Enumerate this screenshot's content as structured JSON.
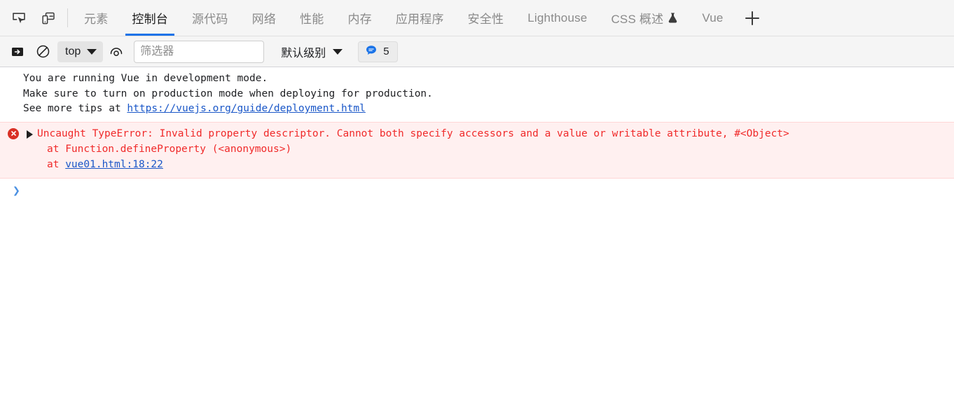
{
  "window": {
    "title": "Chrome DevTools - Console"
  },
  "tabbar": {
    "inspect_icon": "inspect-element-icon",
    "device_icon": "device-toolbar-icon",
    "add_label": "+",
    "tabs": [
      {
        "label": "元素",
        "name": "elements",
        "active": false
      },
      {
        "label": "控制台",
        "name": "console",
        "active": true
      },
      {
        "label": "源代码",
        "name": "sources",
        "active": false
      },
      {
        "label": "网络",
        "name": "network",
        "active": false
      },
      {
        "label": "性能",
        "name": "performance",
        "active": false
      },
      {
        "label": "内存",
        "name": "memory",
        "active": false
      },
      {
        "label": "应用程序",
        "name": "application",
        "active": false
      },
      {
        "label": "安全性",
        "name": "security",
        "active": false
      },
      {
        "label": "Lighthouse",
        "name": "lighthouse",
        "active": false
      },
      {
        "label": "CSS 概述",
        "name": "css-overview",
        "active": false,
        "experimental": true
      },
      {
        "label": "Vue",
        "name": "vue",
        "active": false
      }
    ]
  },
  "toolbar": {
    "sidebar_toggle_icon": "console-sidebar-icon",
    "clear_icon": "clear-console-icon",
    "eye_icon": "live-expression-icon",
    "context": "top",
    "filter_placeholder": "筛选器",
    "filter_value": "",
    "level": "默认级别",
    "issues_count": "5",
    "issues_icon": "issues-bubble-icon"
  },
  "console": {
    "messages": [
      {
        "type": "info",
        "name": "vue-dev-mode-message",
        "line1": "You are running Vue in development mode.",
        "line2": "Make sure to turn on production mode when deploying for production.",
        "line3_prefix": "See more tips at ",
        "link": "https://vuejs.org/guide/deployment.html"
      },
      {
        "type": "error",
        "name": "uncaught-typeerror-message",
        "text": "Uncaught TypeError: Invalid property descriptor. Cannot both specify accessors and a value or writable attribute, #<Object>",
        "stack1": "at Function.defineProperty (<anonymous>)",
        "stack2_prefix": "at ",
        "stack2_link": "vue01.html:18:22"
      }
    ],
    "prompt_chevron": "❯"
  },
  "colors": {
    "accent": "#1a73e8",
    "error_text": "#f02a2a",
    "error_bg": "#fff0f0",
    "error_icon": "#d93025",
    "link": "#1a57c8",
    "toolbar_bg": "#f5f5f5",
    "prompt": "#4a90e2"
  }
}
